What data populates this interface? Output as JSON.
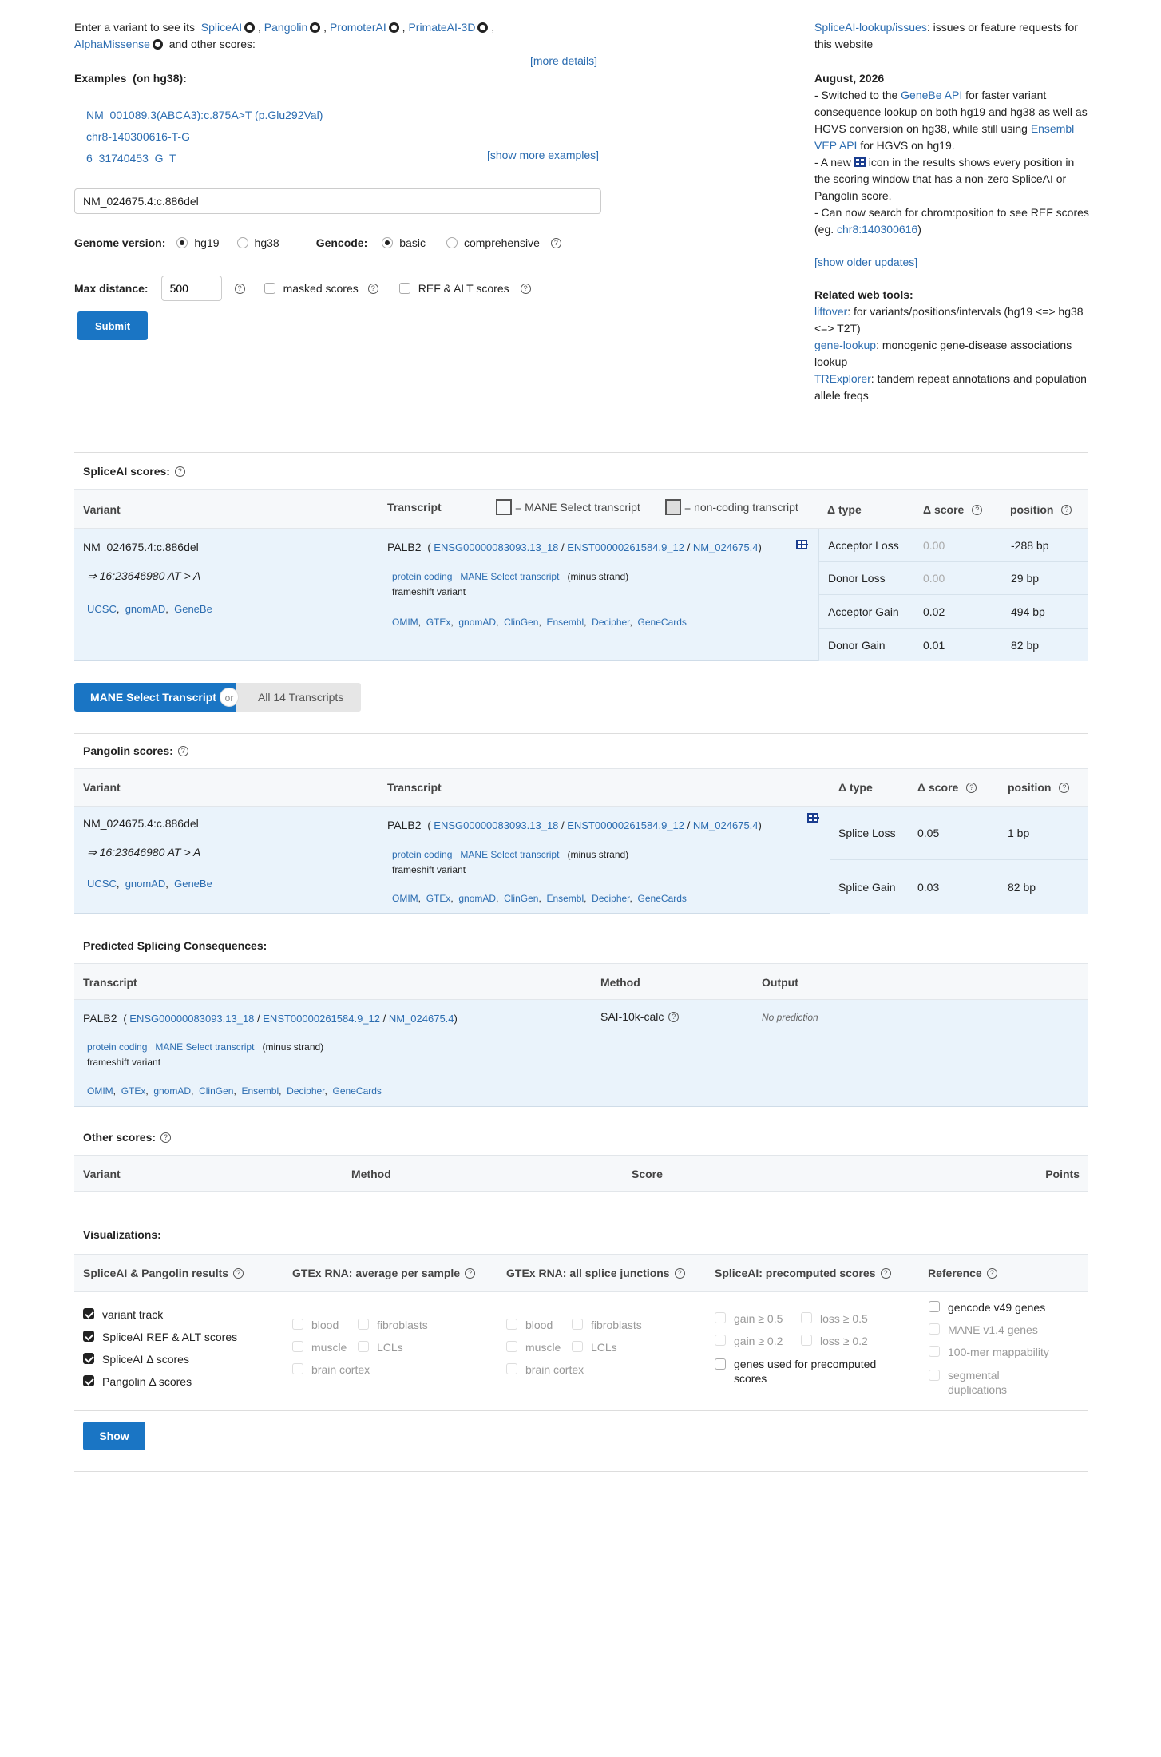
{
  "intro": {
    "prefix": "Enter a variant to see its",
    "tools": [
      "SpliceAI",
      "Pangolin",
      "PromoterAI",
      "PrimateAI-3D",
      "AlphaMissense"
    ],
    "suffix": "and other scores:",
    "more_details": "[more details]"
  },
  "examples": {
    "title": "Examples",
    "build": "(on hg38):",
    "items": [
      "NM_001089.3(ABCA3):c.875A>T (p.Glu292Val)",
      "chr8-140300616-T-G",
      "6  31740453  G  T"
    ],
    "show_more": "[show more examples]"
  },
  "form": {
    "variant_value": "NM_024675.4:c.886del",
    "genome_label": "Genome version:",
    "genome_options": [
      "hg19",
      "hg38"
    ],
    "gencode_label": "Gencode:",
    "gencode_options": [
      "basic",
      "comprehensive"
    ],
    "max_distance_label": "Max distance:",
    "max_distance_value": "500",
    "masked_label": "masked scores",
    "refalt_label": "REF & ALT scores",
    "submit": "Submit"
  },
  "news": {
    "issues_link": "SpliceAI-lookup/issues",
    "issues_text": ": issues or feature requests for this website",
    "date": "August, 2026",
    "u1a": "- Switched to the ",
    "u1_link1": "GeneBe API",
    "u1b": " for faster variant consequence lookup on both hg19 and hg38 as well as HGVS conversion on hg38, while still using ",
    "u1_link2": "Ensembl VEP API",
    "u1c": " for HGVS on hg19.",
    "u2a": "- A new ",
    "u2b": " icon in the results shows every position in the scoring window that has a non-zero SpliceAI or Pangolin score.",
    "u3a": "- Can now search for chrom:position to see REF scores (eg. ",
    "u3_link": "chr8:140300616",
    "u3b": ")",
    "older": "[show older updates]",
    "related_title": "Related web tools:",
    "r1_link": "liftover",
    "r1_text": ": for variants/positions/intervals (hg19 <=> hg38 <=> T2T)",
    "r2_link": "gene-lookup",
    "r2_text": ": monogenic gene-disease associations lookup",
    "r3_link": "TRExplorer",
    "r3_text": ": tandem repeat annotations and population allele freqs"
  },
  "spliceai": {
    "title": "SpliceAI scores:",
    "headers": {
      "variant": "Variant",
      "transcript": "Transcript",
      "mane_legend": "= MANE Select transcript",
      "noncoding_legend": "= non-coding transcript",
      "type": "Δ type",
      "score": "Δ score",
      "position": "position"
    },
    "variant": "NM_024675.4:c.886del",
    "variant_pos": "⇒ 16:23646980 AT > A",
    "variant_links": [
      "UCSC",
      "gnomAD",
      "GeneBe"
    ],
    "gene": "PALB2",
    "ids": [
      "ENSG00000083093.13_18",
      "ENST00000261584.9_12",
      "NM_024675.4"
    ],
    "tags": [
      "protein coding",
      "MANE Select transcript"
    ],
    "strand": "(minus strand)",
    "consequence": "frameshift variant",
    "ext_links": [
      "OMIM",
      "GTEx",
      "gnomAD",
      "ClinGen",
      "Ensembl",
      "Decipher",
      "GeneCards"
    ],
    "rows": [
      {
        "type": "Acceptor Loss",
        "score": "0.00",
        "position": "-288 bp"
      },
      {
        "type": "Donor Loss",
        "score": "0.00",
        "position": "29 bp"
      },
      {
        "type": "Acceptor Gain",
        "score": "0.02",
        "position": "494 bp"
      },
      {
        "type": "Donor Gain",
        "score": "0.01",
        "position": "82 bp"
      }
    ]
  },
  "toggle": {
    "on": "MANE Select Transcript",
    "or": "or",
    "off": "All 14 Transcripts"
  },
  "pangolin": {
    "title": "Pangolin scores:",
    "headers": {
      "variant": "Variant",
      "transcript": "Transcript",
      "type": "Δ type",
      "score": "Δ score",
      "position": "position"
    },
    "rows": [
      {
        "type": "Splice Loss",
        "score": "0.05",
        "position": "1 bp"
      },
      {
        "type": "Splice Gain",
        "score": "0.03",
        "position": "82 bp"
      }
    ]
  },
  "consequences": {
    "title": "Predicted Splicing Consequences:",
    "headers": {
      "transcript": "Transcript",
      "method": "Method",
      "output": "Output"
    },
    "method": "SAI-10k-calc",
    "output": "No prediction"
  },
  "other": {
    "title": "Other scores:",
    "headers": {
      "variant": "Variant",
      "method": "Method",
      "score": "Score",
      "points": "Points"
    }
  },
  "viz": {
    "title": "Visualizations:",
    "headers": [
      "SpliceAI & Pangolin results",
      "GTEx RNA: average per sample",
      "GTEx RNA: all splice junctions",
      "SpliceAI: precomputed scores",
      "Reference"
    ],
    "col1": [
      "variant track",
      "SpliceAI REF & ALT scores",
      "SpliceAI Δ scores",
      "Pangolin Δ scores"
    ],
    "gtex": [
      "blood",
      "fibroblasts",
      "muscle",
      "LCLs",
      "brain cortex"
    ],
    "pre": [
      "gain ≥ 0.5",
      "loss ≥ 0.5",
      "gain ≥ 0.2",
      "loss ≥ 0.2",
      "genes used for precomputed scores"
    ],
    "ref": [
      "gencode v49 genes",
      "MANE v1.4 genes",
      "100-mer mappability",
      "segmental duplications"
    ],
    "show": "Show"
  },
  "colors": {
    "link": "#2b6cb0",
    "accent": "#1a75c4",
    "row_bg": "#eaf3fb"
  }
}
